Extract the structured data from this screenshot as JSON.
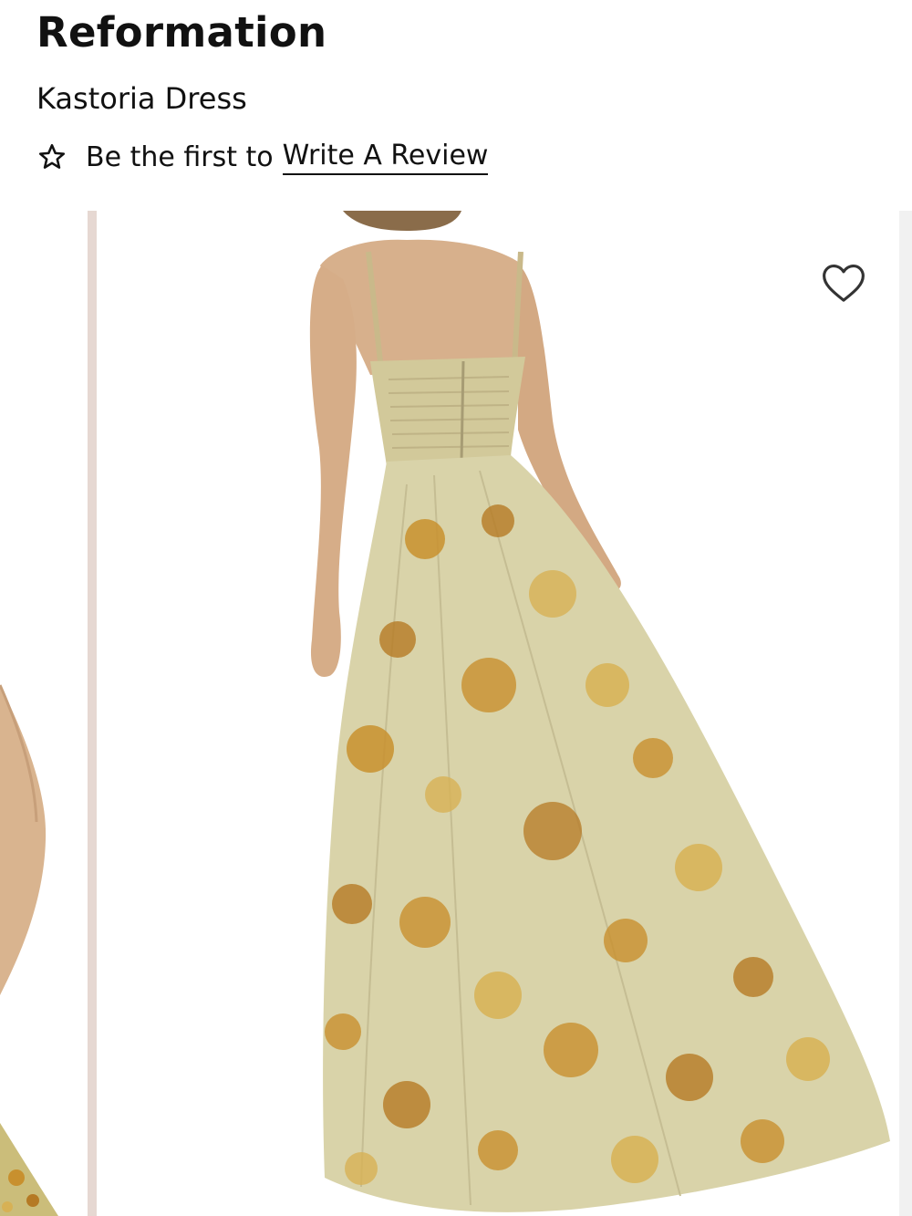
{
  "product": {
    "brand": "Reformation",
    "name": "Kastoria Dress"
  },
  "reviews": {
    "prefix": "Be the first to",
    "link_label": "Write A Review"
  },
  "gallery": {
    "image_subject": "model-back-view",
    "wishlist_icon": "heart-outline-icon",
    "rating_icon": "star-outline-icon",
    "dress_color": "#d9d3a9",
    "print_colors": [
      "#c8902e",
      "#b57a24",
      "#d7b155"
    ],
    "divider_color": "#e6d8d2"
  }
}
